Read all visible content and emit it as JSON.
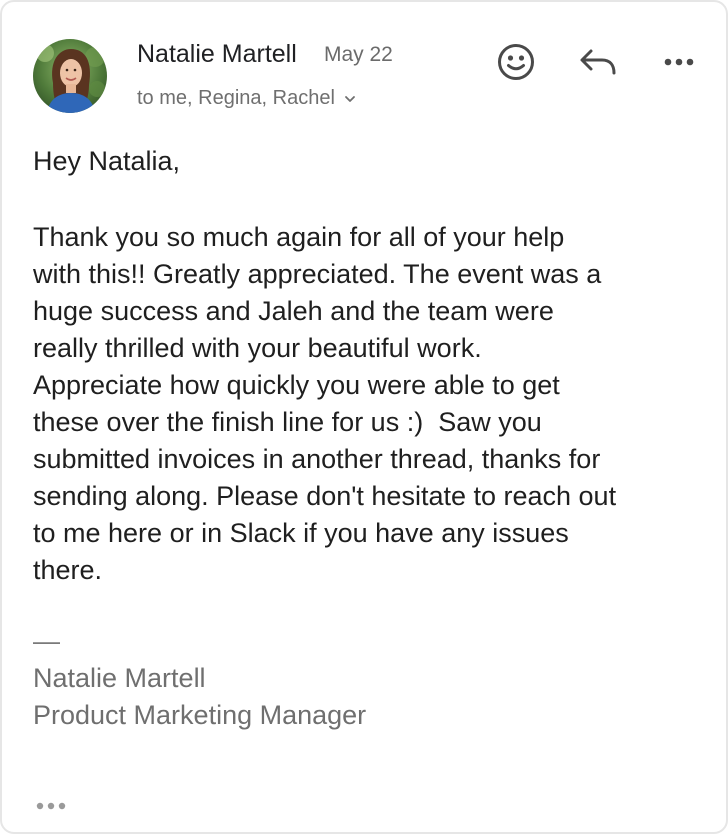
{
  "email": {
    "sender_name": "Natalie Martell",
    "date": "May 22",
    "recipients": "to me, Regina, Rachel",
    "greeting": "Hey Natalia,",
    "body_lines": [
      "Thank you so much again for all of your help",
      "with this!! Greatly appreciated. The event was a",
      "huge success and Jaleh and the team were",
      "really thrilled with your beautiful work.",
      "Appreciate how quickly you were able to get",
      "these over the finish line for us :)  Saw you",
      "submitted invoices in another thread, thanks for",
      "sending along. Please don't hesitate to reach out",
      "to me here or in Slack if you have any issues",
      "there."
    ],
    "signature": {
      "separator": "—",
      "name": "Natalie Martell",
      "title": "Product Marketing Manager"
    }
  },
  "icons": {
    "avatar": "avatar-photo",
    "emoji": "smiley-face-icon",
    "reply": "reply-arrow-icon",
    "more": "more-horizontal-icon",
    "expand_recipients": "chevron-down-icon",
    "trimmed_content": "ellipsis-icon"
  },
  "colors": {
    "text_primary": "#1f1f1f",
    "text_secondary": "#6f6f6f",
    "icon": "#4a4a4a",
    "card_border": "#e6e6e6"
  }
}
